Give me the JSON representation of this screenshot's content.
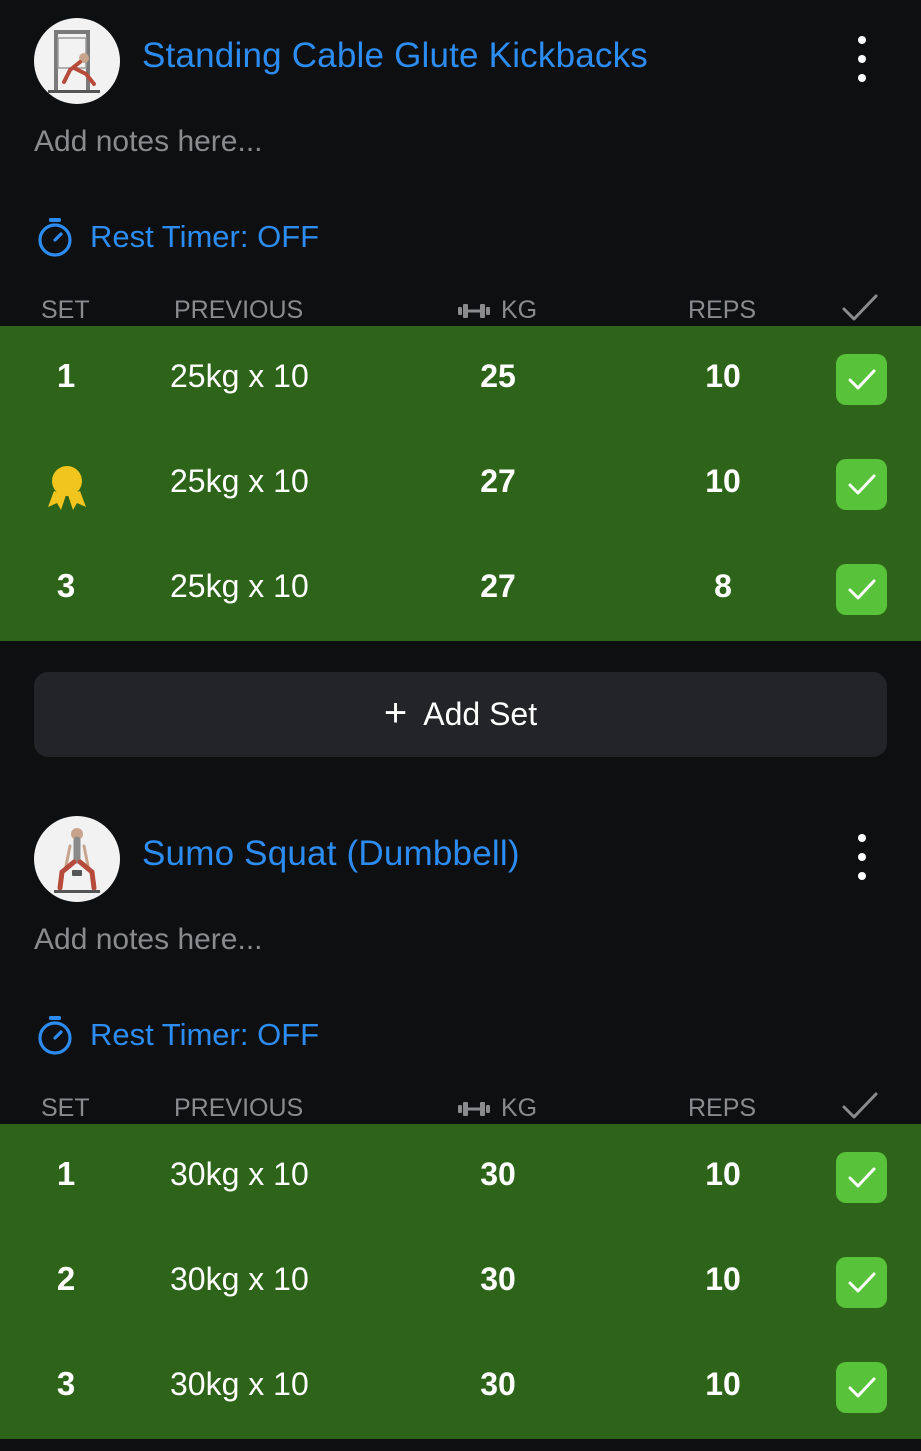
{
  "exercises": [
    {
      "name": "Standing Cable Glute Kickbacks",
      "thumbnail_icon": "cable-kickback-icon",
      "notes_placeholder": "Add notes here...",
      "rest_timer": "Rest Timer: OFF",
      "columns": {
        "set": "SET",
        "previous": "PREVIOUS",
        "kg": "KG",
        "reps": "REPS"
      },
      "sets": [
        {
          "set": "1",
          "previous": "25kg x 10",
          "kg": "25",
          "reps": "10",
          "done": true,
          "badge": null
        },
        {
          "set": "2",
          "previous": "25kg x 10",
          "kg": "27",
          "reps": "10",
          "done": true,
          "badge": "medal-icon"
        },
        {
          "set": "3",
          "previous": "25kg x 10",
          "kg": "27",
          "reps": "8",
          "done": true,
          "badge": null
        }
      ],
      "add_set_label": "Add Set"
    },
    {
      "name": "Sumo Squat (Dumbbell)",
      "thumbnail_icon": "sumo-squat-icon",
      "notes_placeholder": "Add notes here...",
      "rest_timer": "Rest Timer: OFF",
      "columns": {
        "set": "SET",
        "previous": "PREVIOUS",
        "kg": "KG",
        "reps": "REPS"
      },
      "sets": [
        {
          "set": "1",
          "previous": "30kg x 10",
          "kg": "30",
          "reps": "10",
          "done": true,
          "badge": null
        },
        {
          "set": "2",
          "previous": "30kg x 10",
          "kg": "30",
          "reps": "10",
          "done": true,
          "badge": null
        },
        {
          "set": "3",
          "previous": "30kg x 10",
          "kg": "30",
          "reps": "10",
          "done": true,
          "badge": null
        }
      ]
    }
  ],
  "colors": {
    "background": "#0e0f11",
    "accent_blue": "#2d8cf0",
    "completed_row": "#2e6419",
    "check_green": "#58c23a",
    "muted_text": "#8b8b8e",
    "medal_gold": "#f2c51e"
  }
}
